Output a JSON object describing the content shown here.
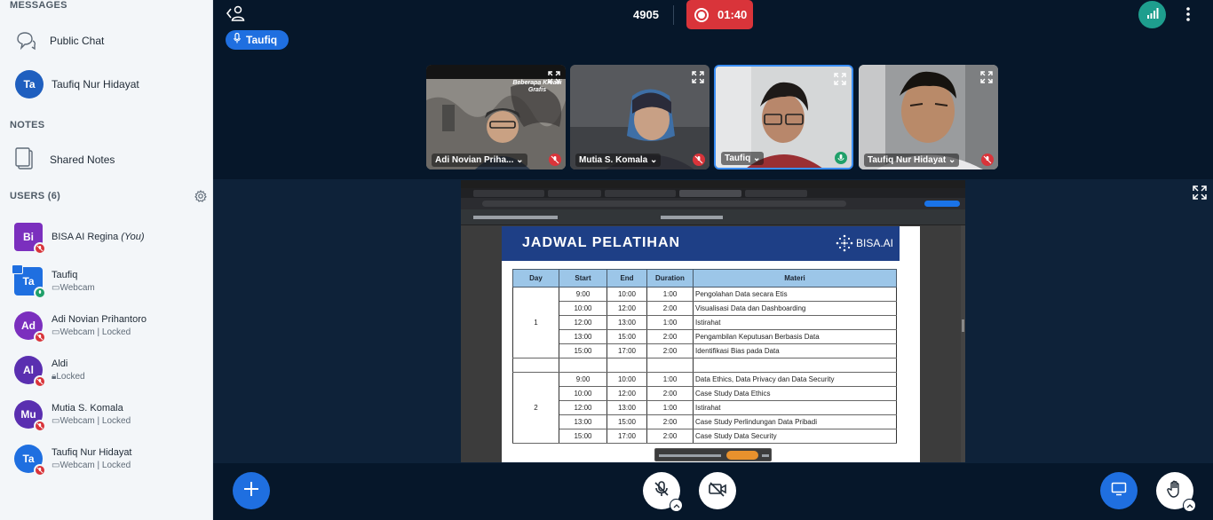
{
  "sidebar": {
    "messages_title": "MESSAGES",
    "public_chat": "Public Chat",
    "private_chat": {
      "initials": "Ta",
      "name": "Taufiq Nur Hidayat"
    },
    "notes_title": "NOTES",
    "shared_notes": "Shared Notes",
    "users_title": "USERS (6)",
    "users": [
      {
        "initials": "Bi",
        "name": "BISA AI Regina",
        "you": "(You)",
        "sub": "",
        "color": "#7b2fbe"
      },
      {
        "initials": "Ta",
        "name": "Taufiq",
        "sub": "Webcam",
        "color": "#1f6fe0"
      },
      {
        "initials": "Ad",
        "name": "Adi Novian Prihantoro",
        "sub": "Webcam | Locked",
        "color": "#7b2fbe"
      },
      {
        "initials": "Al",
        "name": "Aldi",
        "sub": "Locked",
        "color": "#5a2fb0"
      },
      {
        "initials": "Mu",
        "name": "Mutia S. Komala",
        "sub": "Webcam | Locked",
        "color": "#5a2fb0"
      },
      {
        "initials": "Ta",
        "name": "Taufiq Nur Hidayat",
        "sub": "Webcam | Locked",
        "color": "#1f6fe0"
      }
    ]
  },
  "topbar": {
    "meeting_id": "4905",
    "recording_time": "01:40",
    "talker": "Taufiq"
  },
  "videos": [
    {
      "name": "Adi Novian Priha...",
      "muted": true,
      "banner": "Beberapa Kreasi Grafis"
    },
    {
      "name": "Mutia S. Komala",
      "muted": true
    },
    {
      "name": "Taufiq",
      "muted": false
    },
    {
      "name": "Taufiq Nur Hidayat",
      "muted": true
    }
  ],
  "slide": {
    "title": "JADWAL PELATIHAN",
    "brand": "BISA.AI",
    "headers": [
      "Day",
      "Start",
      "End",
      "Duration",
      "Materi"
    ],
    "day1": "1",
    "day2": "2",
    "rows_day1": [
      [
        "9:00",
        "10:00",
        "1:00",
        "Pengolahan Data secara Etis"
      ],
      [
        "10:00",
        "12:00",
        "2:00",
        "Visualisasi Data dan Dashboarding"
      ],
      [
        "12:00",
        "13:00",
        "1:00",
        "Istirahat"
      ],
      [
        "13:00",
        "15:00",
        "2:00",
        "Pengambilan Keputusan Berbasis Data"
      ],
      [
        "15:00",
        "17:00",
        "2:00",
        "Identifikasi Bias pada Data"
      ]
    ],
    "rows_day2": [
      [
        "9:00",
        "10:00",
        "1:00",
        "Data Ethics, Data Privacy dan Data Security"
      ],
      [
        "10:00",
        "12:00",
        "2:00",
        "Case Study Data Ethics"
      ],
      [
        "12:00",
        "13:00",
        "1:00",
        "Istirahat"
      ],
      [
        "13:00",
        "15:00",
        "2:00",
        "Case Study Perlindungan Data Pribadi"
      ],
      [
        "15:00",
        "17:00",
        "2:00",
        "Case Study Data Security"
      ]
    ]
  },
  "colors": {
    "bg": "#06172a",
    "accent": "#1f6fe0",
    "record": "#d9343a",
    "slide_header": "#1e3f86"
  }
}
